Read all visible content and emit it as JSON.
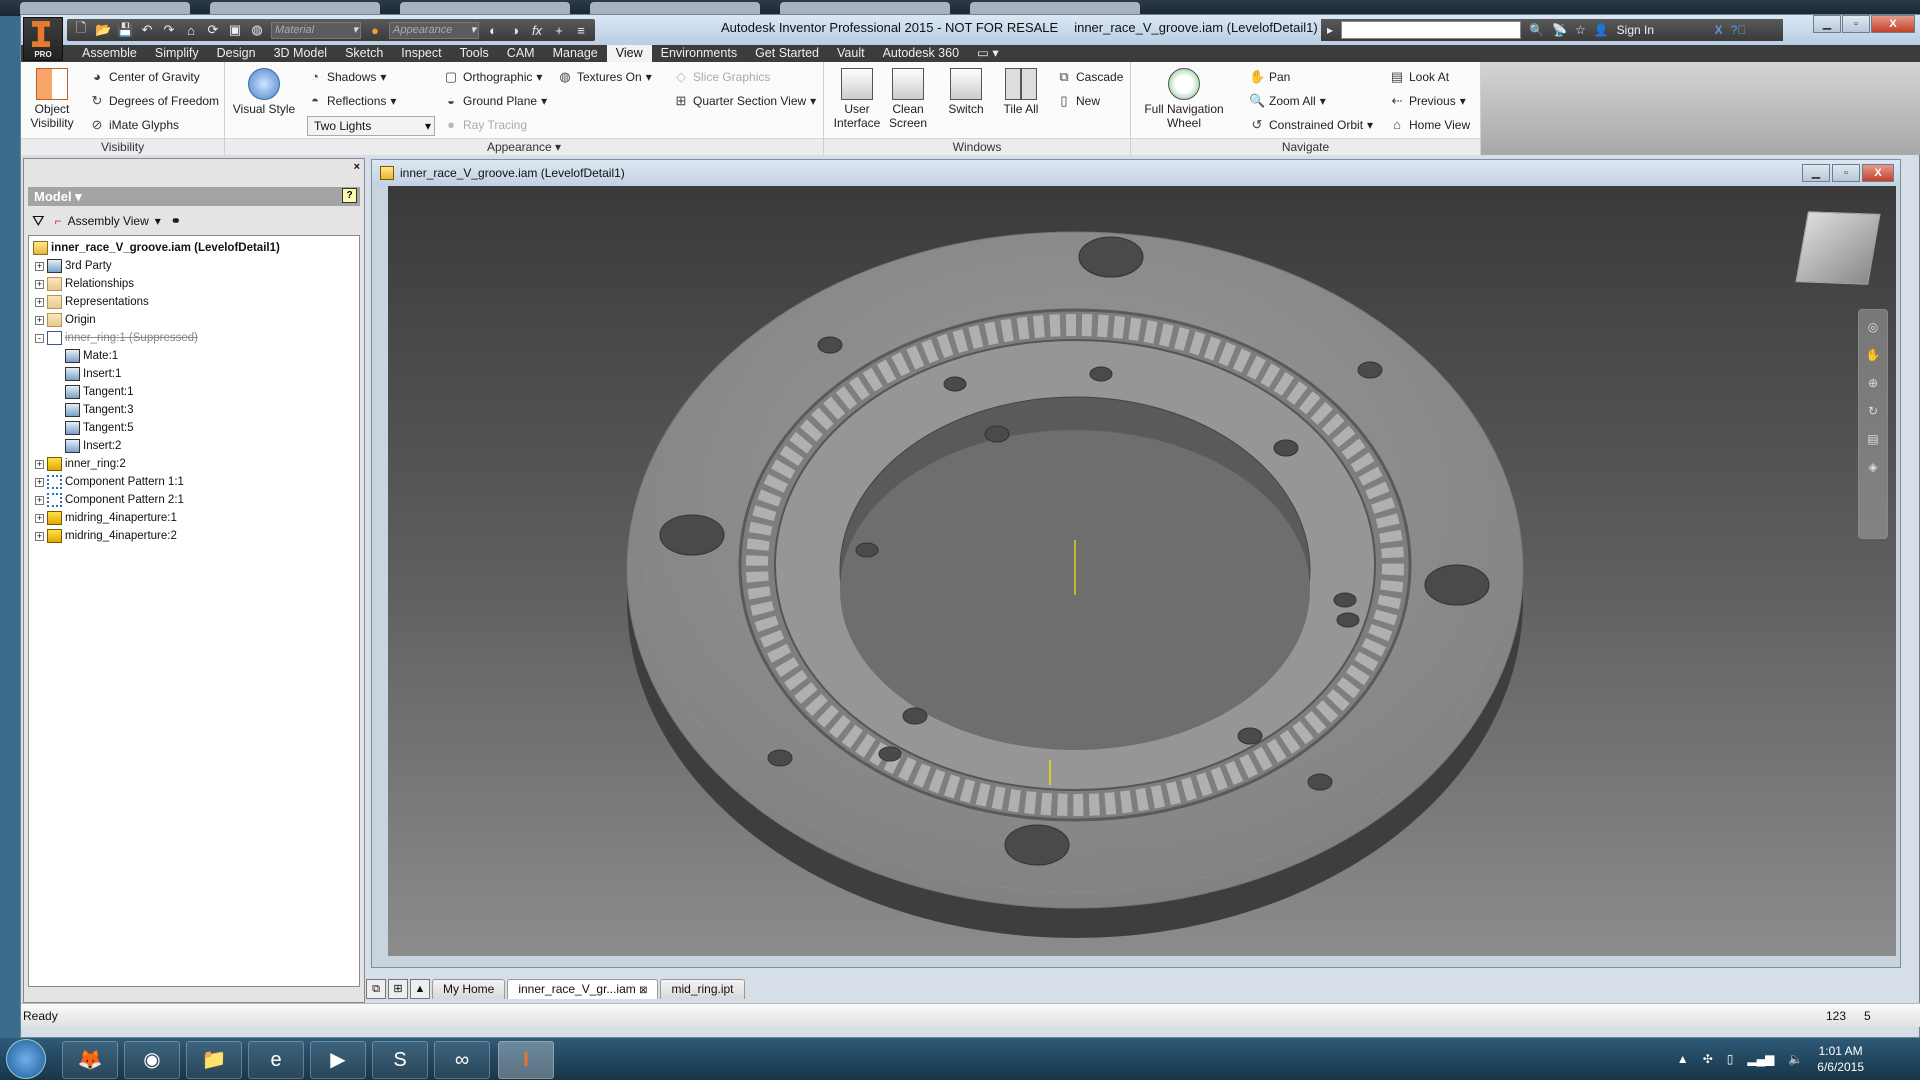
{
  "window": {
    "title": "Autodesk Inventor Professional 2015 - NOT FOR RESALE",
    "document": "inner_race_V_groove.iam (LevelofDetail1)"
  },
  "app_logo": {
    "badge": "PRO"
  },
  "quick_access": {
    "material_placeholder": "Material",
    "appearance_placeholder": "Appearance"
  },
  "infocenter": {
    "sign_in": "Sign In"
  },
  "ribbon_tabs": [
    "Assemble",
    "Simplify",
    "Design",
    "3D Model",
    "Sketch",
    "Inspect",
    "Tools",
    "CAM",
    "Manage",
    "View",
    "Environments",
    "Get Started",
    "Vault",
    "Autodesk 360"
  ],
  "active_tab": "View",
  "panels": {
    "visibility": {
      "label": "Visibility",
      "object_visibility": "Object Visibility",
      "center_of_gravity": "Center of Gravity",
      "degrees_of_freedom": "Degrees of Freedom",
      "imate_glyphs": "iMate Glyphs"
    },
    "appearance": {
      "label": "Appearance",
      "visual_style": "Visual Style",
      "shadows": "Shadows",
      "reflections": "Reflections",
      "lighting": "Two Lights",
      "orthographic": "Orthographic",
      "ground_plane": "Ground Plane",
      "ray_tracing": "Ray Tracing",
      "textures": "Textures On",
      "slice_graphics": "Slice Graphics",
      "quarter_section": "Quarter Section View"
    },
    "windows": {
      "label": "Windows",
      "user_interface": "User Interface",
      "clean_screen": "Clean Screen",
      "switch": "Switch",
      "tile_all": "Tile All",
      "cascade": "Cascade",
      "new": "New"
    },
    "navigate": {
      "label": "Navigate",
      "full_nav_wheel": "Full Navigation Wheel",
      "pan": "Pan",
      "zoom_all": "Zoom All",
      "constrained_orbit": "Constrained Orbit",
      "look_at": "Look At",
      "previous": "Previous",
      "home_view": "Home View"
    }
  },
  "browser": {
    "title": "Model",
    "view": "Assembly View",
    "tree": [
      {
        "label": "inner_race_V_groove.iam (LevelofDetail1)",
        "level": 0,
        "icon": "assembly-icon",
        "bold": true
      },
      {
        "label": "3rd Party",
        "level": 1,
        "icon": "third-party-icon",
        "expander": "+"
      },
      {
        "label": "Relationships",
        "level": 1,
        "icon": "folder-icon",
        "expander": "+"
      },
      {
        "label": "Representations",
        "level": 1,
        "icon": "representations-icon",
        "expander": "+"
      },
      {
        "label": "Origin",
        "level": 1,
        "icon": "folder-icon",
        "expander": "+"
      },
      {
        "label": "inner_ring:1 (Suppressed)",
        "level": 1,
        "icon": "part-icon",
        "expander": "-",
        "suppressed": true
      },
      {
        "label": "Mate:1",
        "level": 2,
        "icon": "mate-constraint-icon"
      },
      {
        "label": "Insert:1",
        "level": 2,
        "icon": "insert-constraint-icon"
      },
      {
        "label": "Tangent:1",
        "level": 2,
        "icon": "tangent-constraint-icon"
      },
      {
        "label": "Tangent:3",
        "level": 2,
        "icon": "tangent-constraint-icon"
      },
      {
        "label": "Tangent:5",
        "level": 2,
        "icon": "tangent-constraint-icon"
      },
      {
        "label": "Insert:2",
        "level": 2,
        "icon": "insert-constraint-icon"
      },
      {
        "label": "inner_ring:2",
        "level": 1,
        "icon": "part-icon",
        "expander": "+"
      },
      {
        "label": "Component Pattern 1:1",
        "level": 1,
        "icon": "pattern-icon",
        "expander": "+"
      },
      {
        "label": "Component Pattern 2:1",
        "level": 1,
        "icon": "pattern-icon",
        "expander": "+"
      },
      {
        "label": "midring_4inaperture:1",
        "level": 1,
        "icon": "part-icon",
        "expander": "+"
      },
      {
        "label": "midring_4inaperture:2",
        "level": 1,
        "icon": "part-icon",
        "expander": "+"
      }
    ]
  },
  "graphics_window": {
    "title": "inner_race_V_groove.iam (LevelofDetail1)"
  },
  "document_tabs": [
    {
      "label": "My Home"
    },
    {
      "label": "inner_race_V_gr...iam",
      "active": true
    },
    {
      "label": "mid_ring.ipt"
    }
  ],
  "status": {
    "text": "Ready",
    "count1": "123",
    "count2": "5"
  },
  "taskbar": {
    "time": "1:01 AM",
    "date": "6/6/2015",
    "apps": [
      "firefox-icon",
      "chrome-icon",
      "explorer-icon",
      "ie-icon",
      "media-player-icon",
      "skype-icon",
      "arduino-icon",
      "inventor-icon"
    ]
  },
  "colors": {
    "accent": "#e8782a",
    "ribbon_bar": "#3c3c3c",
    "viewport_top": "#3a3a3a",
    "viewport_bottom": "#8c8c8c"
  }
}
